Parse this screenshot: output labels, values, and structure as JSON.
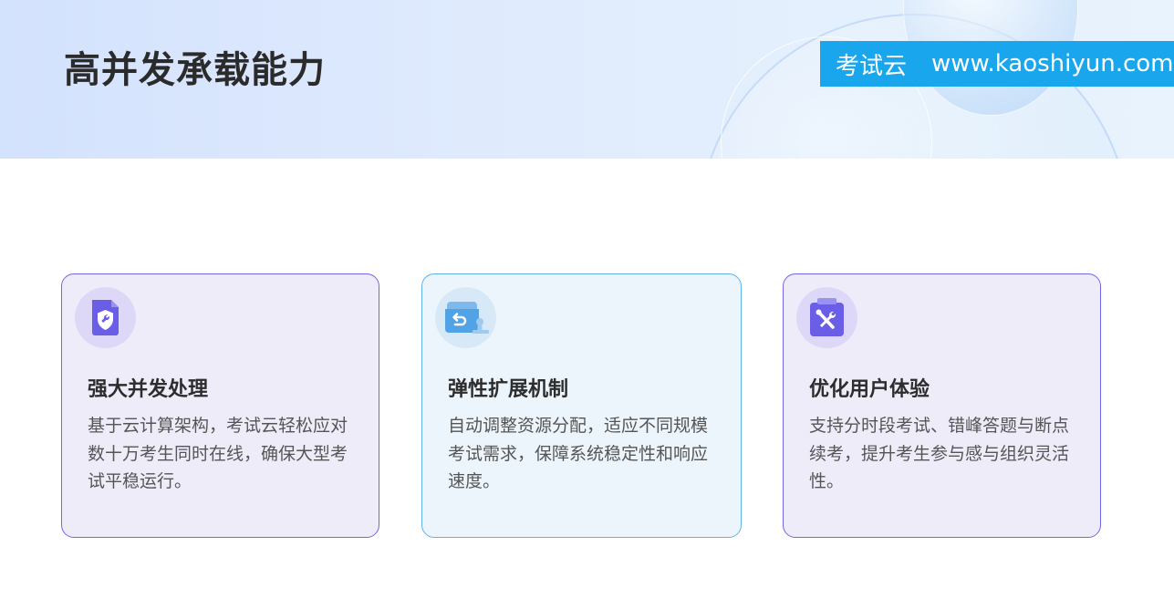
{
  "header": {
    "title": "高并发承载能力",
    "brand_name": "考试云",
    "brand_url": "www.kaoshiyun.com"
  },
  "cards": [
    {
      "icon": "shield-document-icon",
      "title": "强大并发处理",
      "description": "基于云计算架构，考试云轻松应对数十万考生同时在线，确保大型考试平稳运行。"
    },
    {
      "icon": "storage-box-icon",
      "title": "弹性扩展机制",
      "description": "自动调整资源分配，适应不同规模考试需求，保障系统稳定性和响应速度。"
    },
    {
      "icon": "clipboard-tools-icon",
      "title": "优化用户体验",
      "description": "支持分时段考试、错峰答题与断点续考，提升考生参与感与组织灵活性。"
    }
  ],
  "colors": {
    "brand_bar": "#1aa6ec",
    "purple_border": "#7166e5",
    "blue_border": "#5eb1ea",
    "purple_icon": "#6b5ee6",
    "blue_icon": "#52a3e6"
  }
}
